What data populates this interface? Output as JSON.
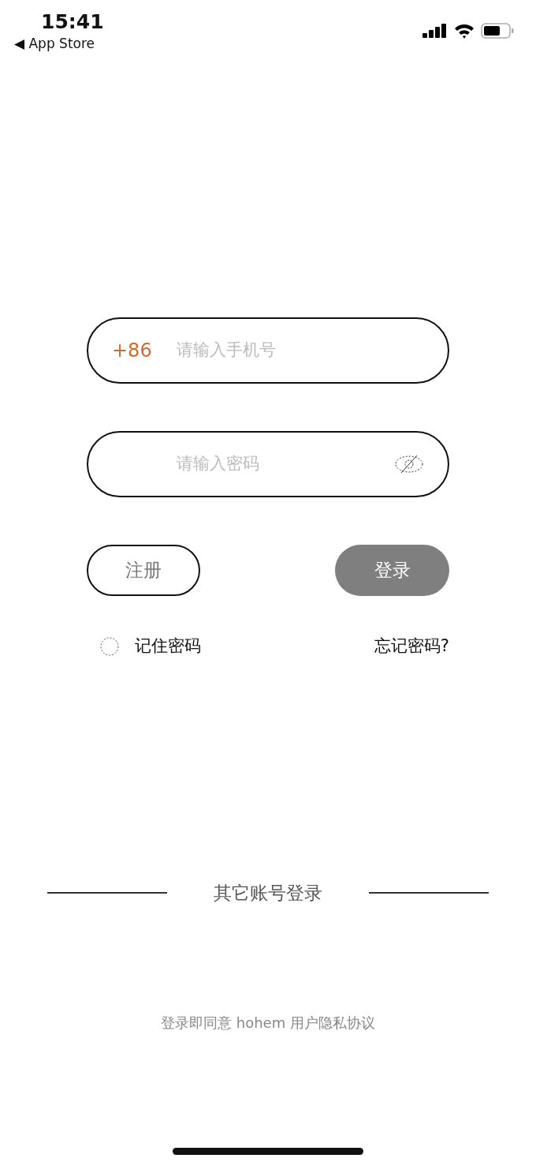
{
  "status_bar": {
    "time": "15:41",
    "back_label": "◀ App Store"
  },
  "phone_field": {
    "country_code": "+86",
    "placeholder": "请输入手机号"
  },
  "password_field": {
    "placeholder": "请输入密码"
  },
  "buttons": [
    {
      "kind": "outline",
      "label": "注册"
    },
    {
      "kind": "filled",
      "label": "登录"
    }
  ],
  "remember": {
    "label": "记住密码",
    "checked": false
  },
  "forgot_link": "忘记密码?",
  "other_login": "其它账号登录",
  "agreement": "登录即同意 hohem 用户隐私协议"
}
